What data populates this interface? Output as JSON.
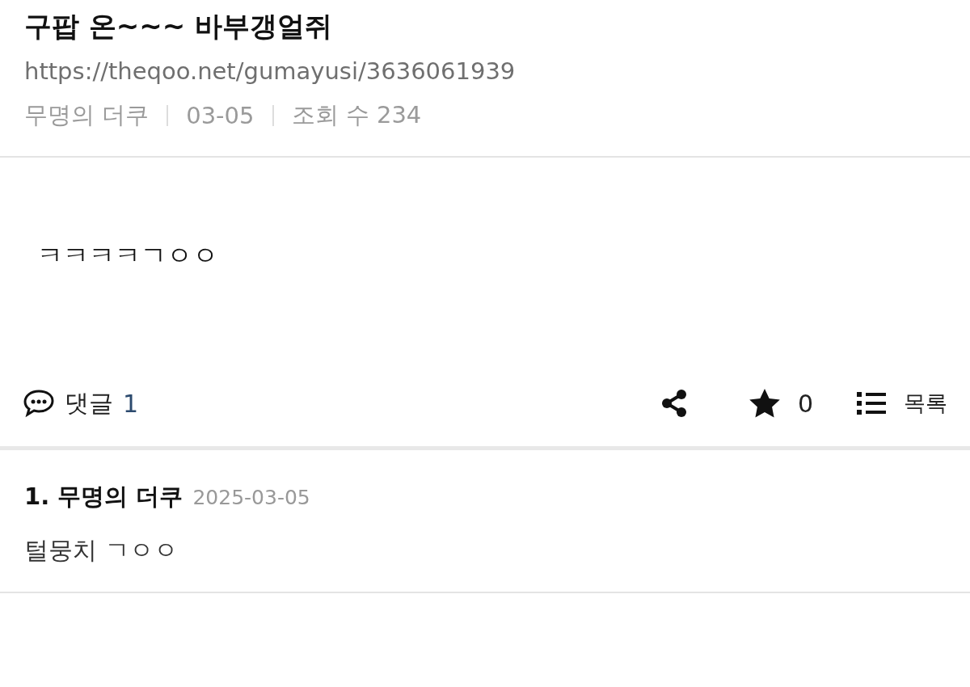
{
  "post": {
    "title": "구팝 온~~~ 바부갱얼쥐",
    "url": "https://theqoo.net/gumayusi/3636061939",
    "meta": [
      "무명의 더쿠",
      "03-05",
      "조회 수 234"
    ],
    "body": "ㅋㅋㅋㅋㄱㅇㅇ"
  },
  "actions": {
    "comments_label": "댓글",
    "comments_count": "1",
    "star_count": "0",
    "list_label": "목록"
  },
  "comments": [
    {
      "number": "1.",
      "author": "무명의 더쿠",
      "date": "2025-03-05",
      "text": "털뭉치 ㄱㅇㅇ"
    }
  ]
}
